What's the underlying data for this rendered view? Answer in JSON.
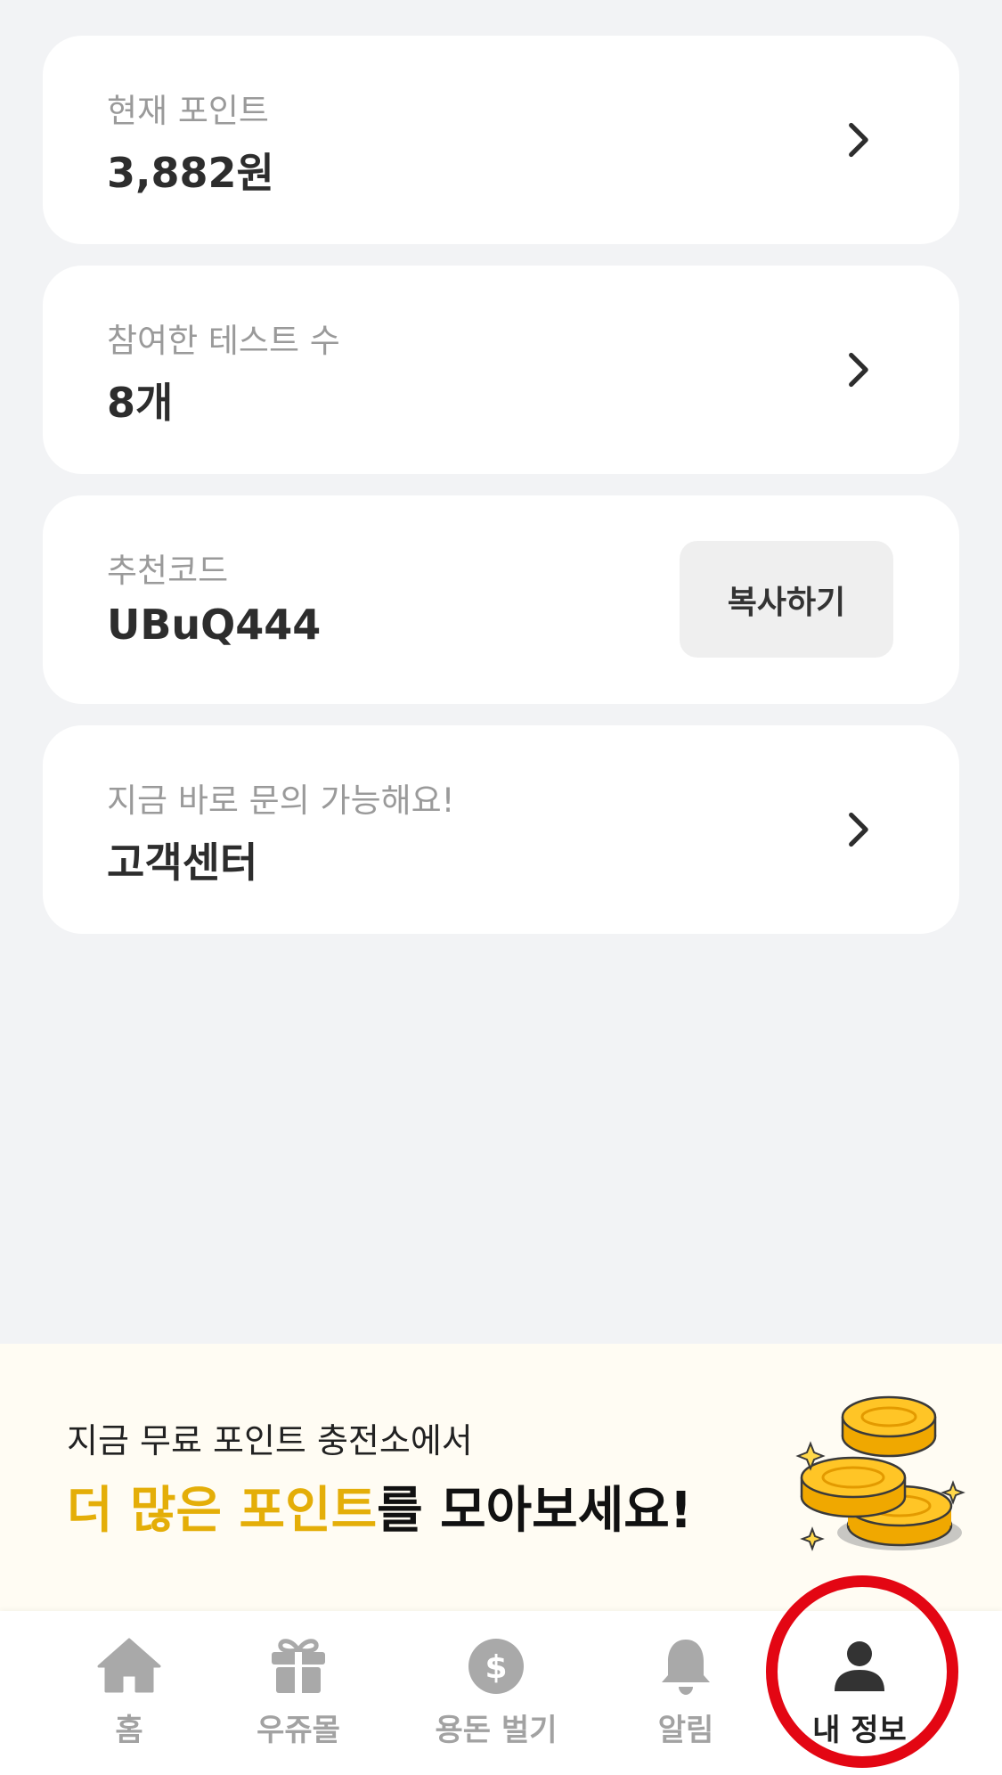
{
  "cards": [
    {
      "label": "현재 포인트",
      "value": "3,882원"
    },
    {
      "label": "참여한 테스트 수",
      "value": "8개"
    },
    {
      "label": "추천코드",
      "value": "UBuQ444",
      "button": "복사하기"
    },
    {
      "label": "지금 바로 문의 가능해요!",
      "value": "고객센터"
    }
  ],
  "promo": {
    "sub": "지금 무료 포인트 충전소에서",
    "highlight": "더 많은 포인트",
    "rest": "를 모아보세요!"
  },
  "tabs": [
    {
      "label": "홈",
      "icon": "home-icon"
    },
    {
      "label": "우쥬몰",
      "icon": "gift-icon"
    },
    {
      "label": "용돈 벌기",
      "icon": "dollar-icon"
    },
    {
      "label": "알림",
      "icon": "bell-icon"
    },
    {
      "label": "내 정보",
      "icon": "person-icon",
      "active": true
    }
  ],
  "colors": {
    "background": "#f2f3f5",
    "highlight": "#e4ae08",
    "annotation_ring": "#e30613"
  }
}
